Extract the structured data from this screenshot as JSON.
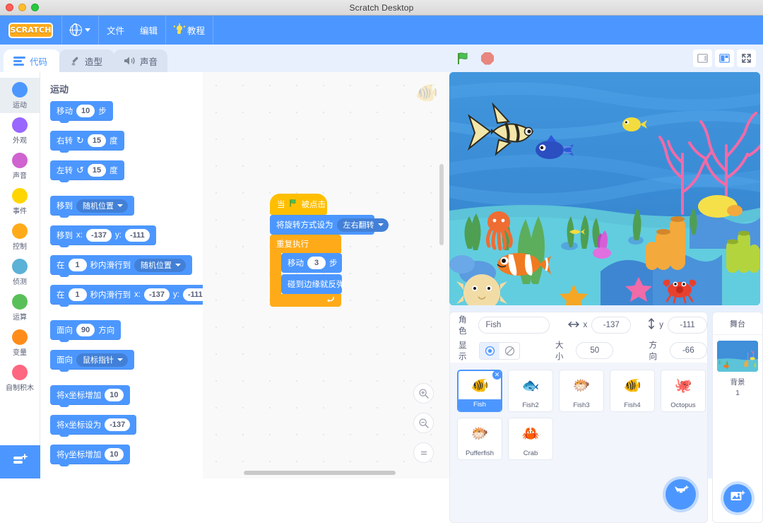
{
  "window": {
    "title": "Scratch Desktop",
    "traffic_lights": [
      "close",
      "minimize",
      "maximize"
    ]
  },
  "menubar": {
    "logo_text": "SCRATCH",
    "language_icon": "globe-icon",
    "items": [
      {
        "label": "文件",
        "icon": ""
      },
      {
        "label": "编辑",
        "icon": ""
      },
      {
        "label": "教程",
        "icon": "lightbulb-icon"
      }
    ]
  },
  "tabs": [
    {
      "label": "代码",
      "icon": "code-blocks-icon",
      "active": true
    },
    {
      "label": "造型",
      "icon": "paintbrush-icon",
      "active": false
    },
    {
      "label": "声音",
      "icon": "speaker-icon",
      "active": false
    }
  ],
  "categories": [
    {
      "label": "运动",
      "color": "#4c97ff",
      "selected": true
    },
    {
      "label": "外观",
      "color": "#9966ff",
      "selected": false
    },
    {
      "label": "声音",
      "color": "#cf63cf",
      "selected": false
    },
    {
      "label": "事件",
      "color": "#ffd500",
      "selected": false
    },
    {
      "label": "控制",
      "color": "#ffab19",
      "selected": false
    },
    {
      "label": "侦测",
      "color": "#5cb1d6",
      "selected": false
    },
    {
      "label": "运算",
      "color": "#59c059",
      "selected": false
    },
    {
      "label": "变量",
      "color": "#ff8c1a",
      "selected": false
    },
    {
      "label": "自制积木",
      "color": "#ff6680",
      "selected": false
    }
  ],
  "extension_button": {
    "name": "add-extension-button",
    "icon": "add-extension-icon"
  },
  "palette": {
    "header": "运动",
    "blocks": [
      {
        "id": "move-steps",
        "parts": [
          {
            "t": "text",
            "v": "移动"
          },
          {
            "t": "oval",
            "v": "10"
          },
          {
            "t": "text",
            "v": "步"
          }
        ]
      },
      {
        "id": "turn-right",
        "parts": [
          {
            "t": "text",
            "v": "右转"
          },
          {
            "t": "icon",
            "v": "↻"
          },
          {
            "t": "oval",
            "v": "15"
          },
          {
            "t": "text",
            "v": "度"
          }
        ]
      },
      {
        "id": "turn-left",
        "parts": [
          {
            "t": "text",
            "v": "左转"
          },
          {
            "t": "icon",
            "v": "↺"
          },
          {
            "t": "oval",
            "v": "15"
          },
          {
            "t": "text",
            "v": "度"
          }
        ]
      },
      {
        "id": "goto-random",
        "parts": [
          {
            "t": "text",
            "v": "移到"
          },
          {
            "t": "drop",
            "v": "随机位置"
          }
        ]
      },
      {
        "id": "goto-xy",
        "parts": [
          {
            "t": "text",
            "v": "移到"
          },
          {
            "t": "text",
            "v": "x:"
          },
          {
            "t": "oval",
            "v": "-137"
          },
          {
            "t": "text",
            "v": "y:"
          },
          {
            "t": "oval",
            "v": "-111"
          }
        ]
      },
      {
        "id": "glide-random",
        "parts": [
          {
            "t": "text",
            "v": "在"
          },
          {
            "t": "oval",
            "v": "1"
          },
          {
            "t": "text",
            "v": "秒内滑行到"
          },
          {
            "t": "drop",
            "v": "随机位置"
          }
        ]
      },
      {
        "id": "glide-xy",
        "parts": [
          {
            "t": "text",
            "v": "在"
          },
          {
            "t": "oval",
            "v": "1"
          },
          {
            "t": "text",
            "v": "秒内滑行到"
          },
          {
            "t": "text",
            "v": "x:"
          },
          {
            "t": "oval",
            "v": "-137"
          },
          {
            "t": "text",
            "v": "y:"
          },
          {
            "t": "oval",
            "v": "-111"
          }
        ]
      },
      {
        "id": "point-direction",
        "parts": [
          {
            "t": "text",
            "v": "面向"
          },
          {
            "t": "oval",
            "v": "90"
          },
          {
            "t": "text",
            "v": "方向"
          }
        ]
      },
      {
        "id": "point-towards",
        "parts": [
          {
            "t": "text",
            "v": "面向"
          },
          {
            "t": "drop",
            "v": "鼠标指针"
          }
        ]
      },
      {
        "id": "change-x-by",
        "parts": [
          {
            "t": "text",
            "v": "将x坐标增加"
          },
          {
            "t": "oval",
            "v": "10"
          }
        ]
      },
      {
        "id": "set-x-to",
        "parts": [
          {
            "t": "text",
            "v": "将x坐标设为"
          },
          {
            "t": "oval",
            "v": "-137"
          }
        ]
      },
      {
        "id": "change-y-by",
        "parts": [
          {
            "t": "text",
            "v": "将y坐标增加"
          },
          {
            "t": "oval",
            "v": "10"
          }
        ]
      }
    ]
  },
  "script": {
    "hat": {
      "pre": "当",
      "icon": "green-flag-icon",
      "post": "被点击"
    },
    "rotation": {
      "label": "将旋转方式设为",
      "value": "左右翻转"
    },
    "repeat": {
      "label": "重复执行",
      "loop_icon": "loop-arrow-icon"
    },
    "inner": [
      {
        "id": "move-3-steps",
        "parts": [
          {
            "t": "text",
            "v": "移动"
          },
          {
            "t": "oval",
            "v": "3"
          },
          {
            "t": "text",
            "v": "步"
          }
        ]
      },
      {
        "id": "if-on-edge-bounce",
        "parts": [
          {
            "t": "text",
            "v": "碰到边缘就反弹"
          }
        ]
      }
    ]
  },
  "workspace_controls": {
    "zoom_in": "zoom-in-icon",
    "zoom_out": "zoom-out-icon",
    "zoom_reset": "zoom-reset-icon"
  },
  "stage_controls": {
    "green_flag": "green-flag-icon",
    "stop": "stop-sign-icon",
    "small_stage": "small-stage-icon",
    "large_stage": "large-stage-icon",
    "fullscreen": "fullscreen-icon"
  },
  "sprite_info": {
    "name_label": "角色",
    "name_value": "Fish",
    "x_label": "x",
    "x_value": "-137",
    "y_label": "y",
    "y_value": "-111",
    "show_label": "显示",
    "show_on_icon": "eye-icon",
    "show_off_icon": "eye-slash-icon",
    "size_label": "大小",
    "size_value": "50",
    "direction_label": "方向",
    "direction_value": "-66"
  },
  "sprites": [
    {
      "name": "Fish",
      "glyph": "🐠",
      "selected": true,
      "delete_icon": "close-icon"
    },
    {
      "name": "Fish2",
      "glyph": "🐟",
      "selected": false
    },
    {
      "name": "Fish3",
      "glyph": "🐡",
      "selected": false
    },
    {
      "name": "Fish4",
      "glyph": "🐠",
      "selected": false
    },
    {
      "name": "Octopus",
      "glyph": "🐙",
      "selected": false
    },
    {
      "name": "Pufferfish",
      "glyph": "🐡",
      "selected": false
    },
    {
      "name": "Crab",
      "glyph": "🦀",
      "selected": false
    }
  ],
  "add_sprite_button": {
    "icon": "add-sprite-cat-icon"
  },
  "stage_panel": {
    "header": "舞台",
    "backdrop_label": "背景",
    "backdrop_count": "1",
    "add_backdrop_icon": "add-backdrop-icon"
  },
  "colors": {
    "accent": "#4c97ff",
    "motion": "#4c97ff",
    "control": "#ffab19",
    "event": "#ffbf00",
    "panel_bg": "#e8f0fe",
    "text": "#575e75"
  }
}
